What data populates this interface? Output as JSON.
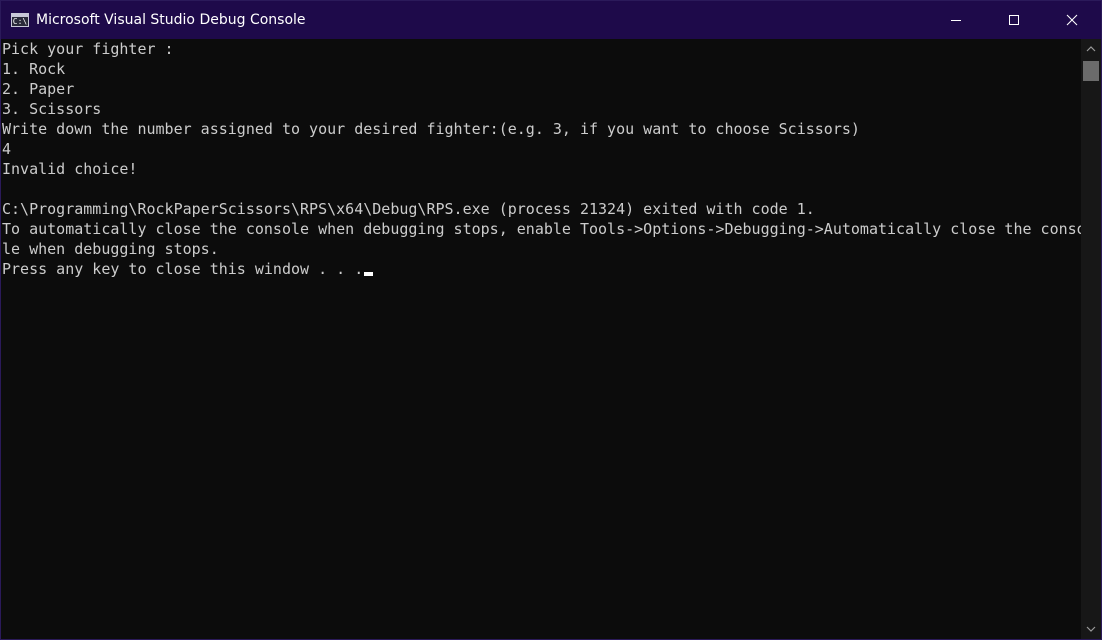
{
  "window": {
    "title": "Microsoft Visual Studio Debug Console",
    "icon_text": "C:\\",
    "titlebar_color": "#1e0a4a",
    "background_color": "#0c0c0c",
    "text_color": "#cccccc"
  },
  "caption_buttons": {
    "minimize": "minimize-icon",
    "maximize": "maximize-icon",
    "close": "close-icon"
  },
  "console": {
    "lines": [
      "Pick your fighter :",
      "1. Rock",
      "2. Paper",
      "3. Scissors",
      "Write down the number assigned to your desired fighter:(e.g. 3, if you want to choose Scissors)",
      "4",
      "Invalid choice!",
      "",
      "C:\\Programming\\RockPaperScissors\\RPS\\x64\\Debug\\RPS.exe (process 21324) exited with code 1.",
      "To automatically close the console when debugging stops, enable Tools->Options->Debugging->Automatically close the conso",
      "le when debugging stops.",
      "Press any key to close this window . . ."
    ]
  }
}
